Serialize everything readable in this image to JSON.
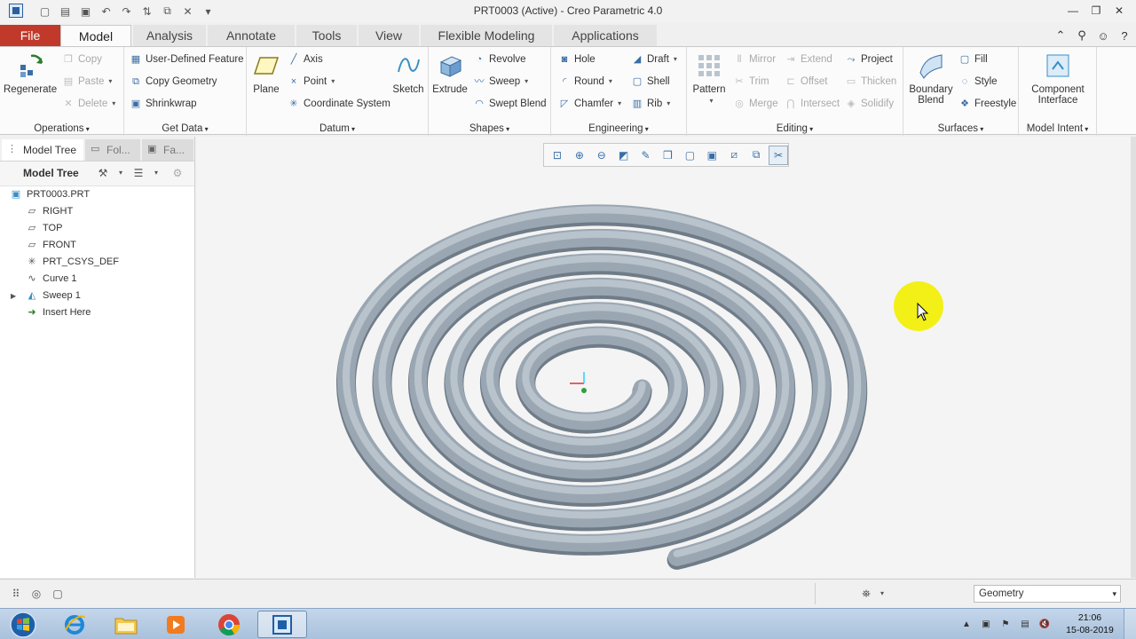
{
  "window": {
    "title": "PRT0003 (Active) - Creo Parametric 4.0"
  },
  "ribbon_tabs": [
    {
      "label": "File"
    },
    {
      "label": "Model"
    },
    {
      "label": "Analysis"
    },
    {
      "label": "Annotate"
    },
    {
      "label": "Tools"
    },
    {
      "label": "View"
    },
    {
      "label": "Flexible Modeling"
    },
    {
      "label": "Applications"
    }
  ],
  "ribbon": {
    "operations": {
      "label": "Operations",
      "regenerate": "Regenerate",
      "copy": "Copy",
      "paste": "Paste",
      "delete": "Delete"
    },
    "get_data": {
      "label": "Get Data",
      "user_defined_feature": "User-Defined Feature",
      "copy_geometry": "Copy Geometry",
      "shrinkwrap": "Shrinkwrap"
    },
    "datum": {
      "label": "Datum",
      "plane": "Plane",
      "axis": "Axis",
      "point": "Point",
      "coordinate_system": "Coordinate System",
      "sketch": "Sketch"
    },
    "shapes": {
      "label": "Shapes",
      "extrude": "Extrude",
      "revolve": "Revolve",
      "sweep": "Sweep",
      "swept_blend": "Swept Blend"
    },
    "engineering": {
      "label": "Engineering",
      "hole": "Hole",
      "round": "Round",
      "chamfer": "Chamfer",
      "draft": "Draft",
      "shell": "Shell",
      "rib": "Rib"
    },
    "editing": {
      "label": "Editing",
      "pattern": "Pattern",
      "mirror": "Mirror",
      "trim": "Trim",
      "merge": "Merge",
      "extend": "Extend",
      "offset": "Offset",
      "intersect": "Intersect",
      "project": "Project",
      "thicken": "Thicken",
      "solidify": "Solidify"
    },
    "surfaces": {
      "label": "Surfaces",
      "boundary_blend_1": "Boundary",
      "boundary_blend_2": "Blend",
      "fill": "Fill",
      "style": "Style",
      "freestyle": "Freestyle"
    },
    "model_intent": {
      "label": "Model Intent",
      "component_interface_1": "Component",
      "component_interface_2": "Interface"
    }
  },
  "nav": {
    "tabs": [
      {
        "label": "Model Tree"
      },
      {
        "label": "Fol..."
      },
      {
        "label": "Fa..."
      }
    ],
    "header": "Model Tree"
  },
  "model_tree": [
    {
      "label": "PRT0003.PRT",
      "icon": "part-icon"
    },
    {
      "label": "RIGHT",
      "icon": "datum-plane-icon"
    },
    {
      "label": "TOP",
      "icon": "datum-plane-icon"
    },
    {
      "label": "FRONT",
      "icon": "datum-plane-icon"
    },
    {
      "label": "PRT_CSYS_DEF",
      "icon": "csys-icon"
    },
    {
      "label": "Curve 1",
      "icon": "curve-icon"
    },
    {
      "label": "Sweep 1",
      "icon": "sweep-icon"
    },
    {
      "label": "Insert Here",
      "icon": "insert-arrow-icon"
    }
  ],
  "status": {
    "filter": "Geometry"
  },
  "taskbar": {
    "time": "21:06",
    "date": "15-08-2019"
  },
  "colors": {
    "file_tab": "#c0392b",
    "model_surface": "#9aa7b3",
    "cursor_highlight": "#f3f000"
  }
}
